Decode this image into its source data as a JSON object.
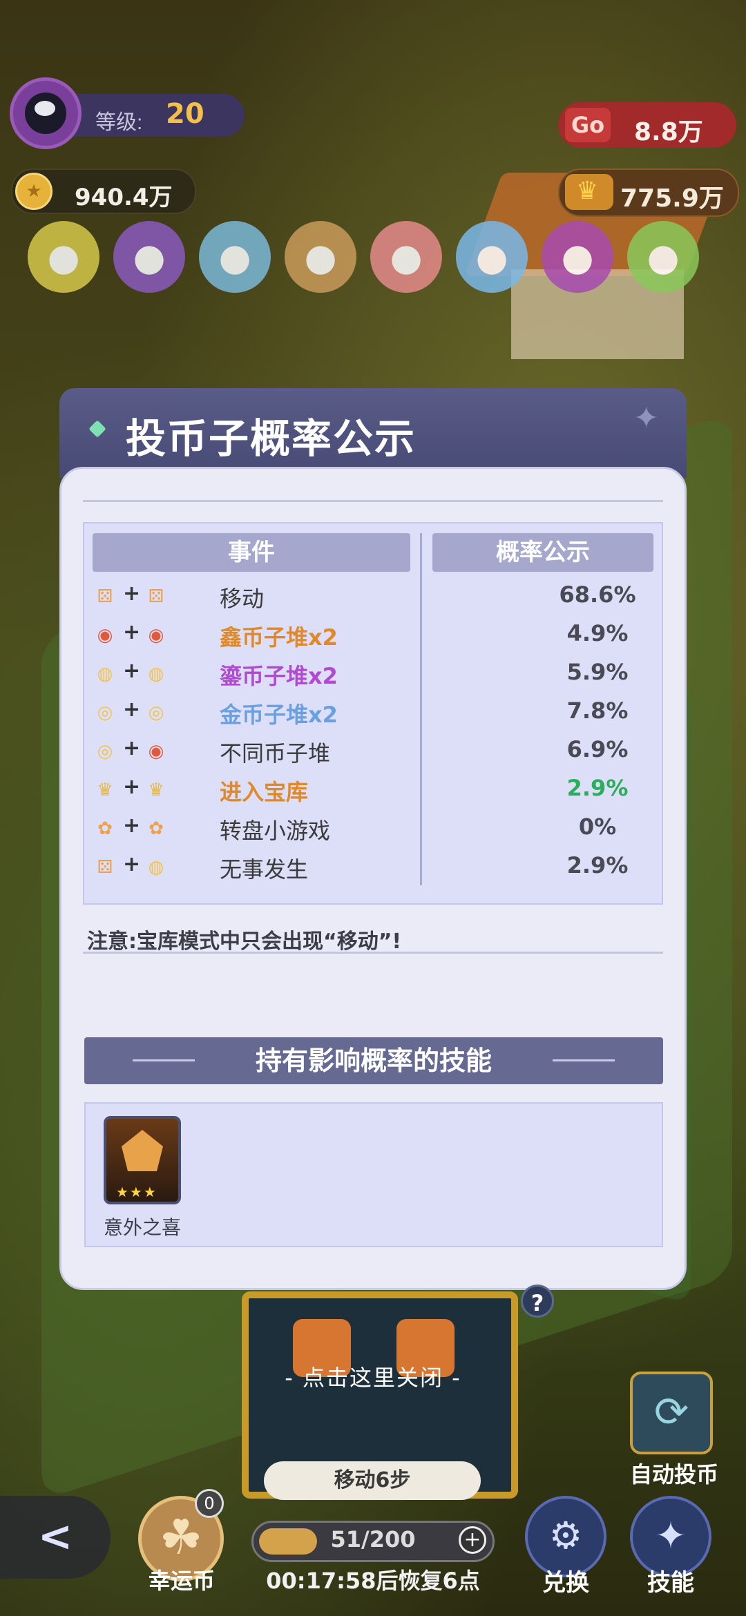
{
  "hud": {
    "level_label": "等级:",
    "level_value": "20",
    "coins": "940.4万",
    "go_icon_text": "Go",
    "go_value": "8.8万",
    "vault_value": "775.9万"
  },
  "pets": [
    "bird-pet",
    "gift-book-pet",
    "blue-bird-pet",
    "bread-pet",
    "pig-pet",
    "pufferfish-pet",
    "gem-pet",
    "green-bird-pet"
  ],
  "modal": {
    "title": "投币子概率公示",
    "col_event": "事件",
    "col_prob": "概率公示",
    "rows": [
      {
        "icon1": "dice-icon",
        "icon2": "dice-icon",
        "event": "移动",
        "event_color": "#3a3a3a",
        "prob": "68.6%",
        "prob_color": "#4a4a55"
      },
      {
        "icon1": "money-bag-icon",
        "icon2": "money-bag-icon",
        "event": "鑫币子堆x2",
        "event_color": "#e0892a",
        "prob": "4.9%",
        "prob_color": "#4a4a55"
      },
      {
        "icon1": "coin-pile-icon",
        "icon2": "coin-pile-icon",
        "event": "鎏币子堆x2",
        "event_color": "#b04ad0",
        "prob": "5.9%",
        "prob_color": "#4a4a55"
      },
      {
        "icon1": "gold-coin-icon",
        "icon2": "gold-coin-icon",
        "event": "金币子堆x2",
        "event_color": "#6aa0e0",
        "prob": "7.8%",
        "prob_color": "#4a4a55"
      },
      {
        "icon1": "gold-coin-icon",
        "icon2": "money-bag-icon",
        "event": "不同币子堆",
        "event_color": "#3a3a3a",
        "prob": "6.9%",
        "prob_color": "#4a4a55"
      },
      {
        "icon1": "crown-icon",
        "icon2": "crown-icon",
        "event": "进入宝库",
        "event_color": "#e0892a",
        "prob": "2.9%",
        "prob_color": "#2aae5a"
      },
      {
        "icon1": "wheel-icon",
        "icon2": "wheel-icon",
        "event": "转盘小游戏",
        "event_color": "#3a3a3a",
        "prob": "0%",
        "prob_color": "#4a4a55"
      },
      {
        "icon1": "dice-icon",
        "icon2": "coin-pile-icon",
        "event": "无事发生",
        "event_color": "#3a3a3a",
        "prob": "2.9%",
        "prob_color": "#4a4a55"
      }
    ],
    "note": "注意:宝库模式中只会出现“移动”!",
    "skills_title": "持有影响概率的技能",
    "skill": {
      "name": "意外之喜",
      "stars": "★★★"
    }
  },
  "bottom": {
    "close_hint": "- 点击这里关闭 -",
    "move_label": "移动6步",
    "auto_label": "自动投币",
    "lucky_label": "幸运币",
    "lucky_badge": "0",
    "energy_text": "51/200",
    "energy_fraction": 0.255,
    "timer": "00:17:58后恢复6点",
    "exchange_label": "兑换",
    "skill_label": "技能"
  },
  "icon_glyphs": {
    "dice-icon": "⚄",
    "money-bag-icon": "◉",
    "coin-pile-icon": "◍",
    "gold-coin-icon": "◎",
    "crown-icon": "♛",
    "wheel-icon": "✿"
  },
  "icon_colors": {
    "dice-icon": "#f0a04a",
    "money-bag-icon": "#e05a3a",
    "coin-pile-icon": "#f2c24a",
    "gold-coin-icon": "#f2c24a",
    "crown-icon": "#e8b83a",
    "wheel-icon": "#f0a04a"
  }
}
